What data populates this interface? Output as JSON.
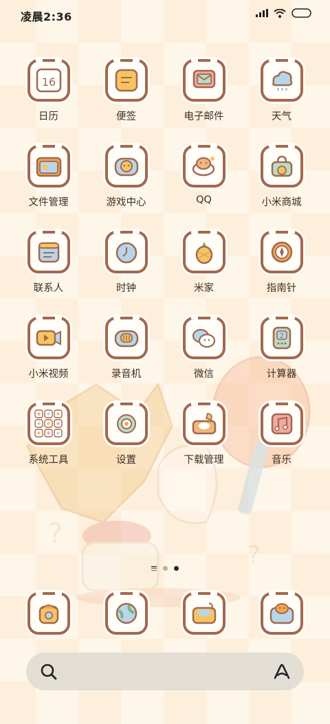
{
  "status_bar": {
    "time": "凌晨2:36"
  },
  "apps": [
    {
      "label": "日历",
      "icon": "calendar-icon"
    },
    {
      "label": "便签",
      "icon": "notes-icon"
    },
    {
      "label": "电子邮件",
      "icon": "email-icon"
    },
    {
      "label": "天气",
      "icon": "weather-icon"
    },
    {
      "label": "文件管理",
      "icon": "file-manager-icon"
    },
    {
      "label": "游戏中心",
      "icon": "game-center-icon"
    },
    {
      "label": "QQ",
      "icon": "qq-icon"
    },
    {
      "label": "小米商城",
      "icon": "mi-store-icon"
    },
    {
      "label": "联系人",
      "icon": "contacts-icon"
    },
    {
      "label": "时钟",
      "icon": "clock-icon"
    },
    {
      "label": "米家",
      "icon": "mijia-icon"
    },
    {
      "label": "指南针",
      "icon": "compass-icon"
    },
    {
      "label": "小米视频",
      "icon": "mi-video-icon"
    },
    {
      "label": "录音机",
      "icon": "recorder-icon"
    },
    {
      "label": "微信",
      "icon": "wechat-icon"
    },
    {
      "label": "计算器",
      "icon": "calculator-icon"
    },
    {
      "label": "系统工具",
      "icon": "system-tools-folder-icon"
    },
    {
      "label": "设置",
      "icon": "settings-icon"
    },
    {
      "label": "下载管理",
      "icon": "download-manager-icon"
    },
    {
      "label": "音乐",
      "icon": "music-icon"
    }
  ],
  "calendar_day": "16",
  "dock": [
    {
      "icon": "phone-icon"
    },
    {
      "icon": "browser-icon"
    },
    {
      "icon": "gallery-icon"
    },
    {
      "icon": "camera-icon"
    }
  ],
  "page_indicator": {
    "pages": 2,
    "current": 2
  },
  "colors": {
    "frame": "#a3684f",
    "background": "#fef6e9",
    "checker": "#fbead0",
    "search_bar": "#dedad2"
  }
}
